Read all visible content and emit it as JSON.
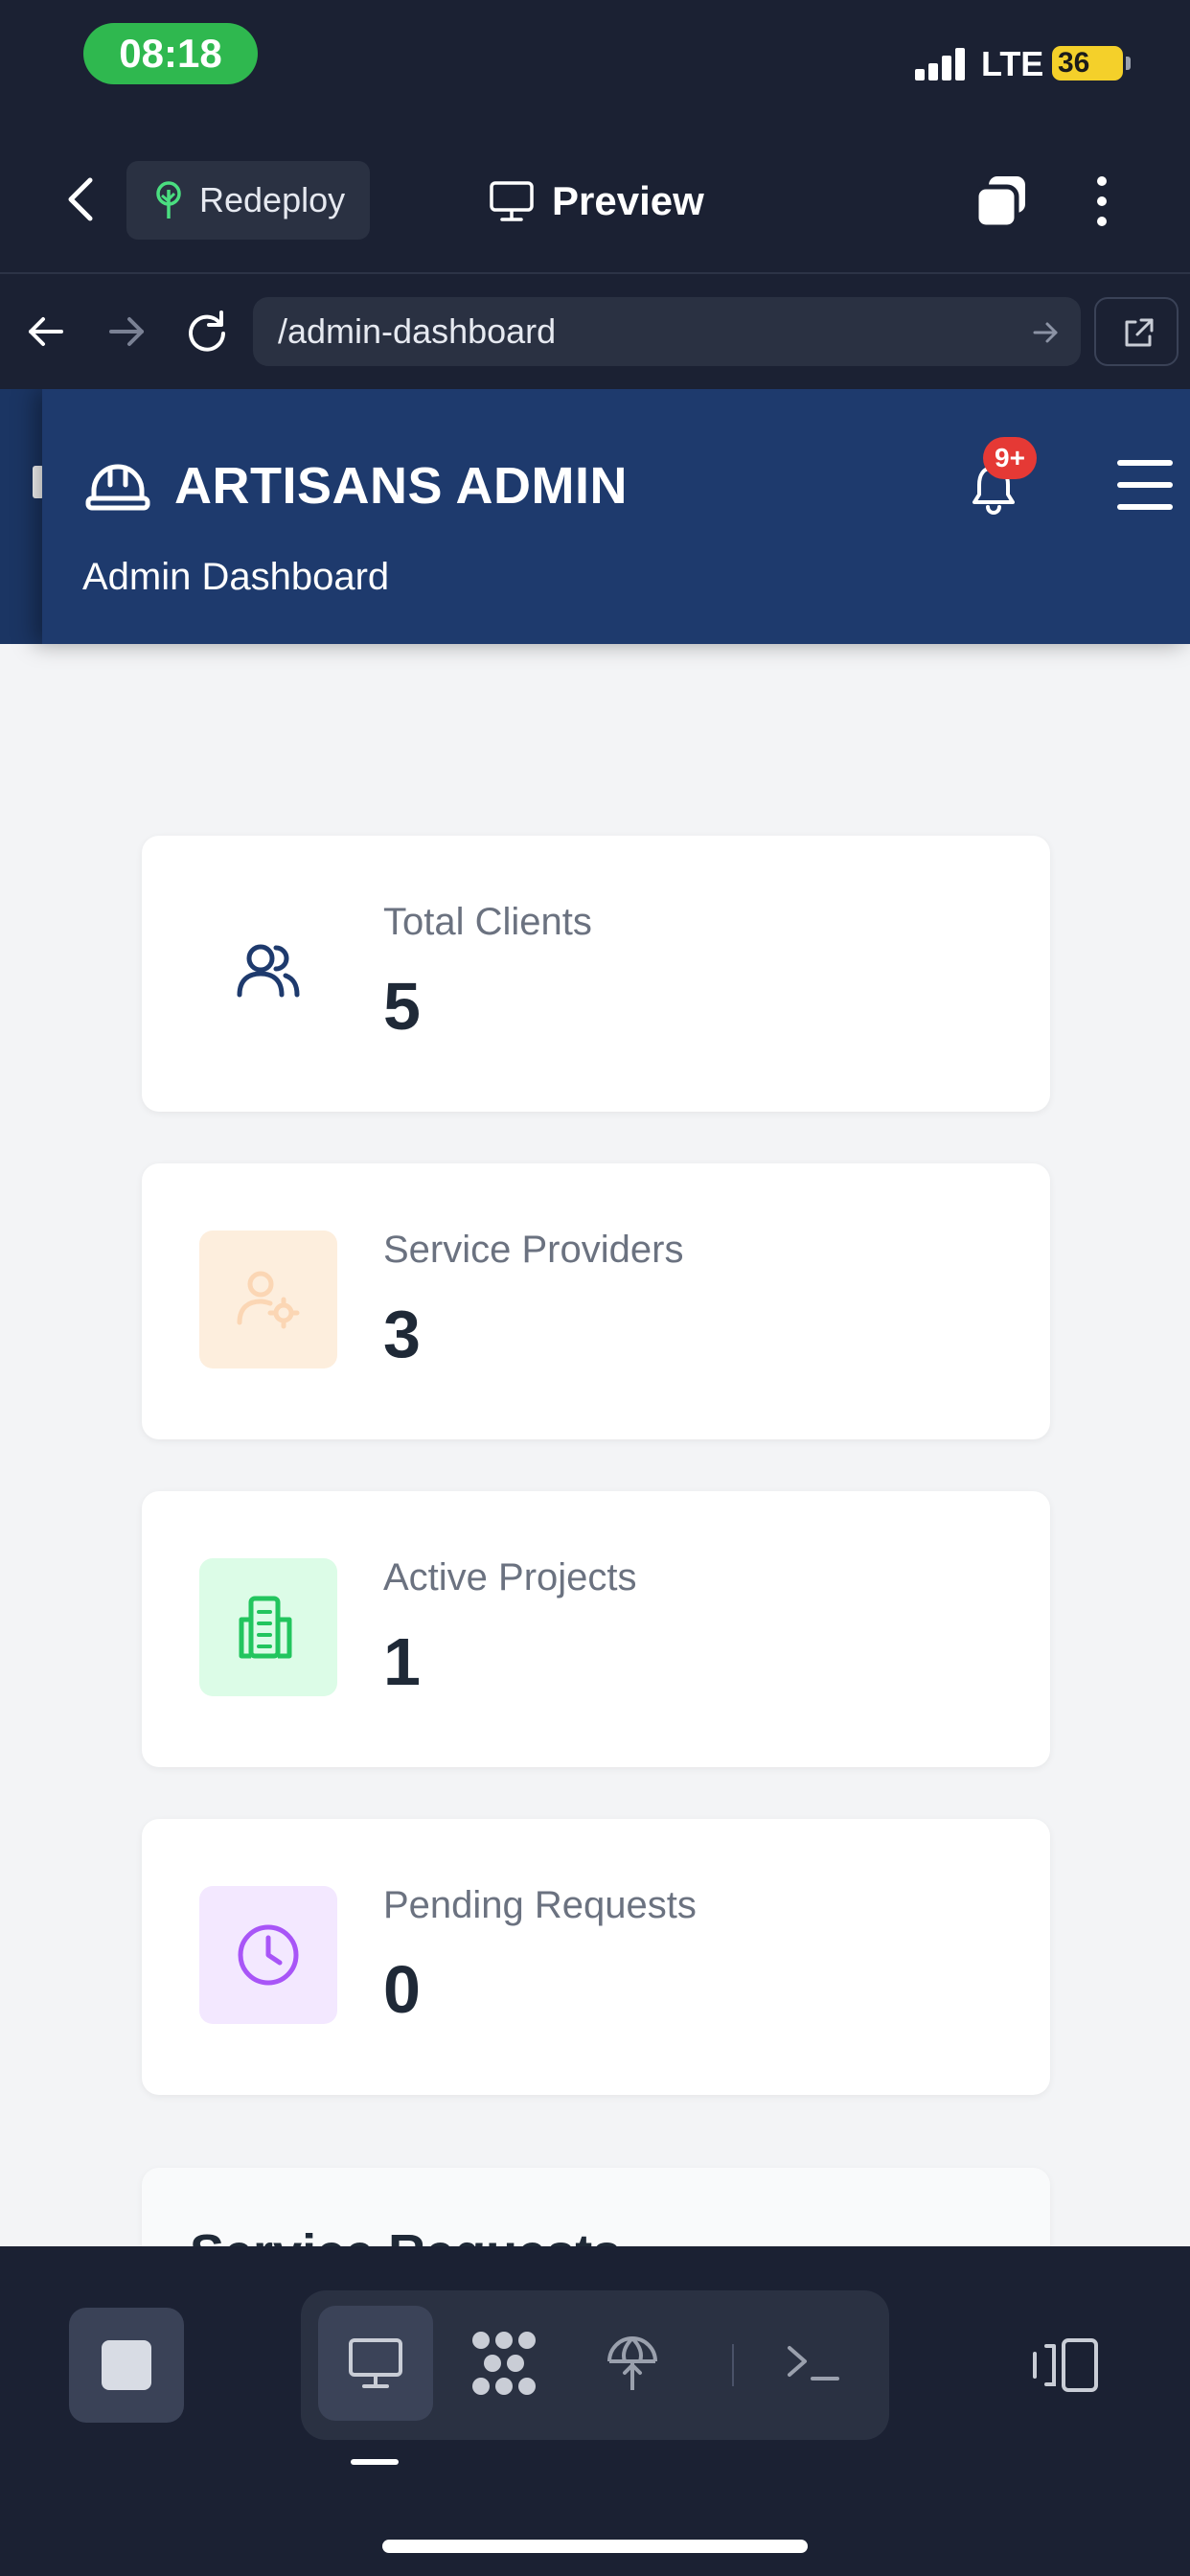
{
  "status": {
    "time": "08:18",
    "network": "LTE",
    "battery": "36"
  },
  "toolbar": {
    "redeploy_label": "Redeploy",
    "preview_label": "Preview"
  },
  "browser": {
    "url": "/admin-dashboard"
  },
  "site": {
    "brand": "ARTISANS ADMIN",
    "subtitle": "Admin Dashboard",
    "notification_badge": "9+"
  },
  "stats": [
    {
      "label": "Total Clients",
      "value": "5",
      "icon": "users-icon",
      "tile_color": "#ffffff",
      "icon_color": "#1e3a6d"
    },
    {
      "label": "Service Providers",
      "value": "3",
      "icon": "user-gear-icon",
      "tile_color": "#fdeedd",
      "icon_color": "#fbd6b4"
    },
    {
      "label": "Active Projects",
      "value": "1",
      "icon": "building-icon",
      "tile_color": "#dcfce7",
      "icon_color": "#22c55e"
    },
    {
      "label": "Pending Requests",
      "value": "0",
      "icon": "clock-icon",
      "tile_color": "#f3e8ff",
      "icon_color": "#a855f7"
    }
  ],
  "section": {
    "title": "Service Requests"
  }
}
